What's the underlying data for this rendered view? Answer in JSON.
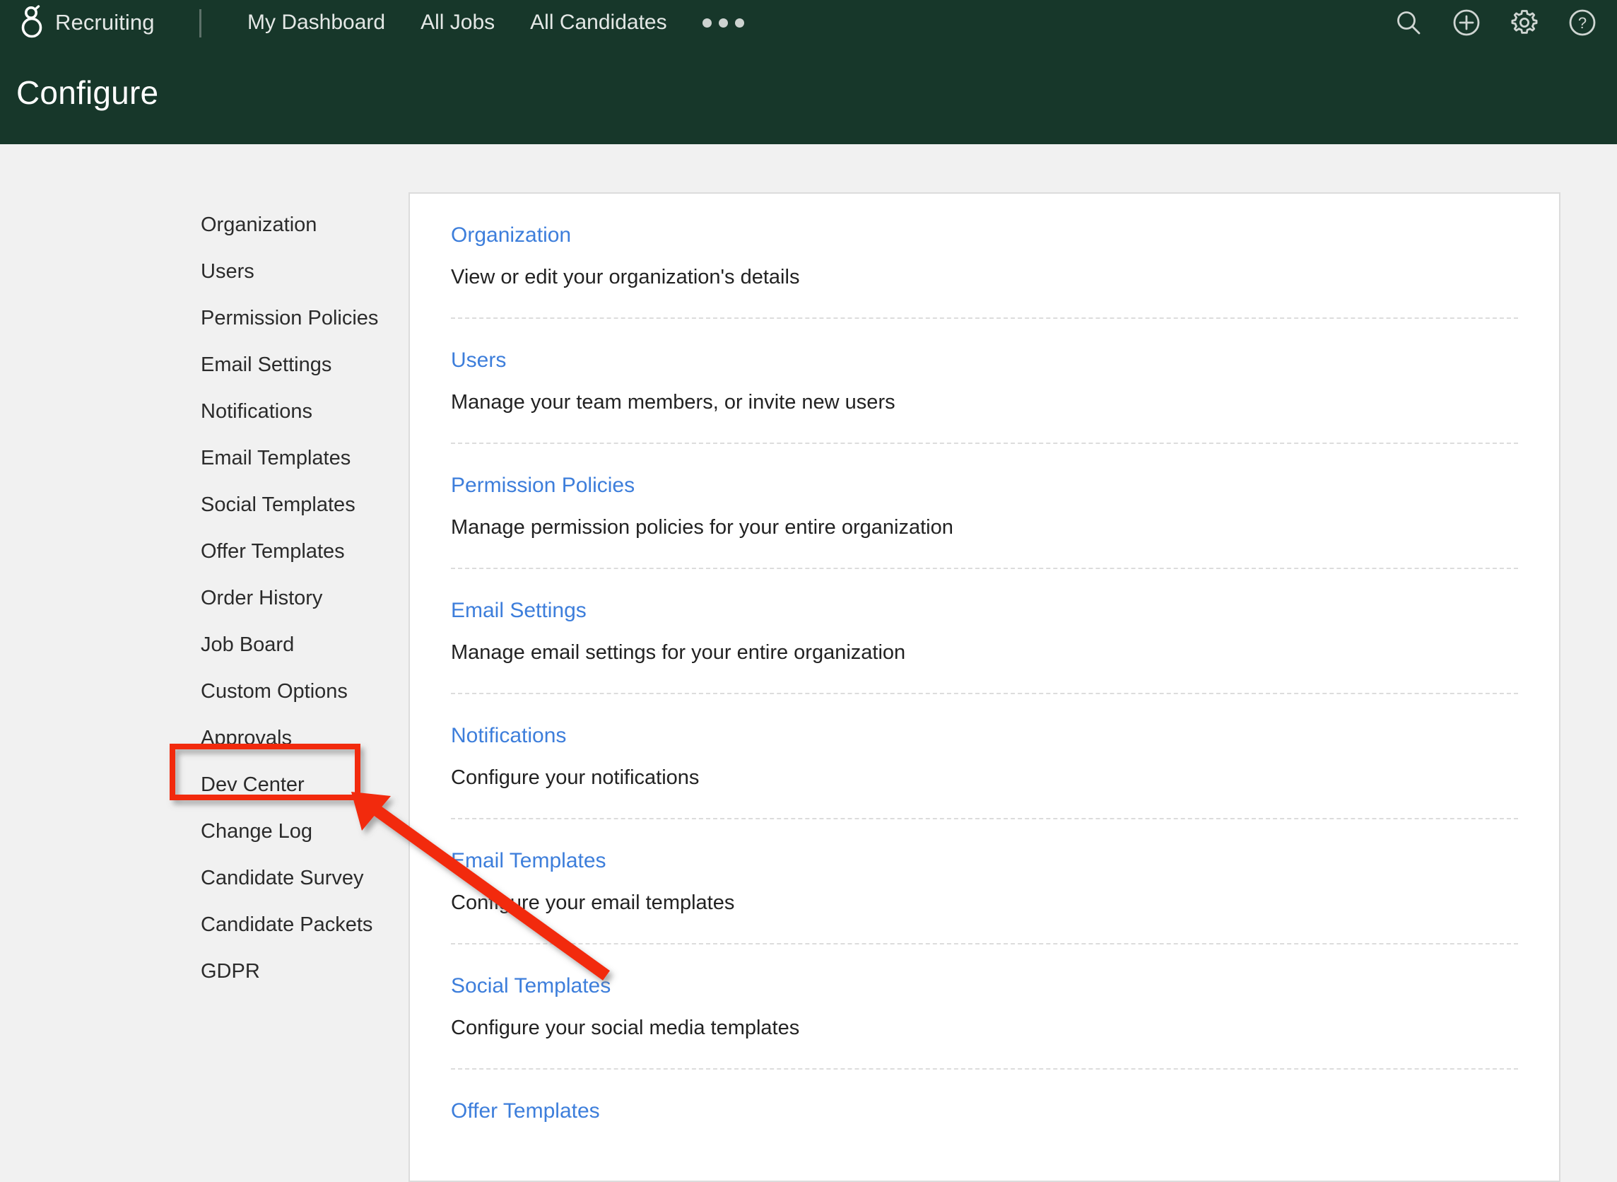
{
  "app": {
    "brand_name": "Recruiting",
    "logo_icon": "greenhouse-g-logo-icon",
    "page_title": "Configure"
  },
  "topnav": {
    "links": [
      {
        "label": "My Dashboard"
      },
      {
        "label": "All Jobs"
      },
      {
        "label": "All Candidates"
      }
    ],
    "overflow_icon": "ellipsis-icon",
    "actions": [
      {
        "icon": "search-icon"
      },
      {
        "icon": "plus-circle-icon"
      },
      {
        "icon": "gear-icon"
      },
      {
        "icon": "help-circle-icon"
      }
    ]
  },
  "sidebar": {
    "items": [
      {
        "label": "Organization"
      },
      {
        "label": "Users"
      },
      {
        "label": "Permission Policies"
      },
      {
        "label": "Email Settings"
      },
      {
        "label": "Notifications"
      },
      {
        "label": "Email Templates"
      },
      {
        "label": "Social Templates"
      },
      {
        "label": "Offer Templates"
      },
      {
        "label": "Order History"
      },
      {
        "label": "Job Board"
      },
      {
        "label": "Custom Options"
      },
      {
        "label": "Approvals"
      },
      {
        "label": "Dev Center"
      },
      {
        "label": "Change Log"
      },
      {
        "label": "Candidate Survey"
      },
      {
        "label": "Candidate Packets"
      },
      {
        "label": "GDPR"
      }
    ]
  },
  "main": {
    "rows": [
      {
        "title": "Organization",
        "desc": "View or edit your organization's details"
      },
      {
        "title": "Users",
        "desc": "Manage your team members, or invite new users"
      },
      {
        "title": "Permission Policies",
        "desc": "Manage permission policies for your entire organization"
      },
      {
        "title": "Email Settings",
        "desc": "Manage email settings for your entire organization"
      },
      {
        "title": "Notifications",
        "desc": "Configure your notifications"
      },
      {
        "title": "Email Templates",
        "desc": "Configure your email templates"
      },
      {
        "title": "Social Templates",
        "desc": "Configure your social media templates"
      },
      {
        "title": "Offer Templates",
        "desc": ""
      }
    ]
  },
  "annotation": {
    "highlight_target": "Dev Center",
    "highlight_color": "#f22a0c",
    "arrow_color": "#f22a0c"
  },
  "colors": {
    "header_green": "#17372a",
    "page_background": "#f1f1f1",
    "card_background": "#ffffff",
    "card_border": "#dcdcdc",
    "link_blue": "#3d7edb",
    "body_text": "#222222",
    "nav_text": "#e4e8e6"
  }
}
